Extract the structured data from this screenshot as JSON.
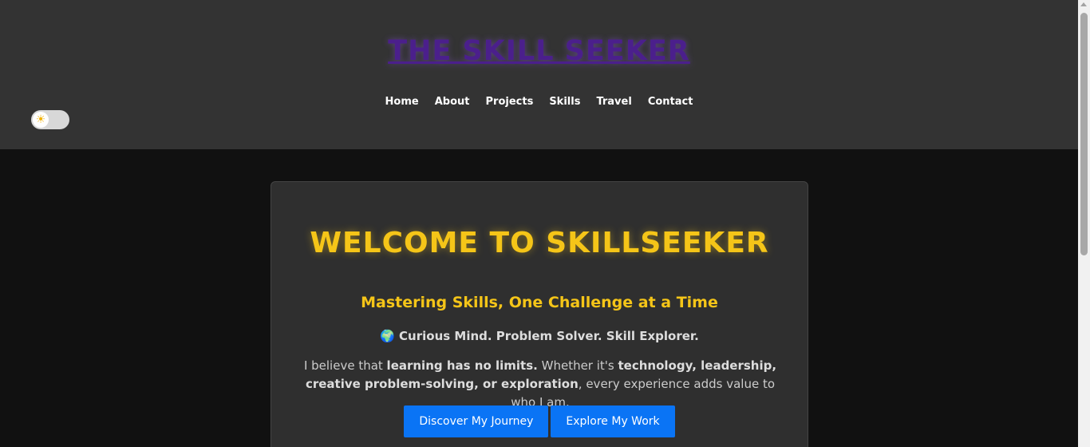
{
  "header": {
    "site_title": "THE SKILL SEEKER",
    "nav": [
      {
        "label": "Home"
      },
      {
        "label": "About"
      },
      {
        "label": "Projects"
      },
      {
        "label": "Skills"
      },
      {
        "label": "Travel"
      },
      {
        "label": "Contact"
      }
    ],
    "theme_toggle": {
      "icon": "sun-icon",
      "glyph": "☀",
      "state": "light"
    }
  },
  "hero": {
    "title": "WELCOME TO SKILLSEEKER",
    "tagline": "Mastering Skills, One Challenge at a Time",
    "motto": "🌍 Curious Mind. Problem Solver. Skill Explorer.",
    "intro": {
      "part1": "I believe that ",
      "bold1": "learning has no limits.",
      "part2": " Whether it's ",
      "bold2": "technology, leadership, creative problem-solving, or exploration",
      "part3": ", every experience adds value to who I am."
    },
    "buttons": {
      "primary": "Discover My Journey",
      "secondary": "Explore My Work"
    }
  },
  "colors": {
    "header_bg": "#333333",
    "page_bg": "#111111",
    "title_purple": "#4b1f8c",
    "accent_gold": "#f5c518",
    "button_blue": "#0a74f5"
  }
}
